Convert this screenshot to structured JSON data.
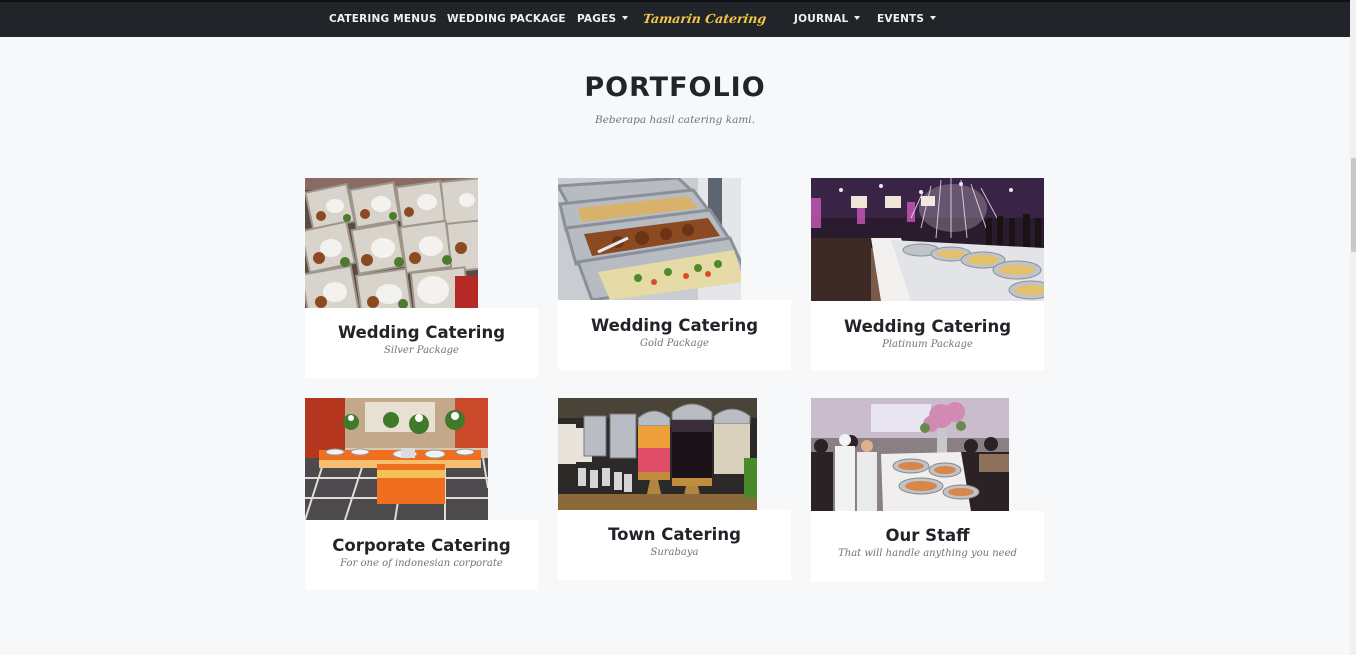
{
  "navbar": {
    "items_left": [
      {
        "label": "CATERING MENUS",
        "dropdown": false
      },
      {
        "label": "WEDDING PACKAGE",
        "dropdown": false
      },
      {
        "label": "PAGES",
        "dropdown": true
      }
    ],
    "brand": "Tamarin Catering",
    "items_right": [
      {
        "label": "JOURNAL",
        "dropdown": true
      },
      {
        "label": "EVENTS",
        "dropdown": true
      }
    ],
    "background_color": "#212429",
    "brand_color": "#f3c64a"
  },
  "portfolio": {
    "title": "PORTFOLIO",
    "subtitle": "Beberapa hasil catering kami.",
    "items": [
      {
        "title": "Wedding Catering",
        "subtitle": "Silver Package",
        "image": "food-boxes-photo"
      },
      {
        "title": "Wedding Catering",
        "subtitle": "Gold Package",
        "image": "chafing-dishes-photo"
      },
      {
        "title": "Wedding Catering",
        "subtitle": "Platinum Package",
        "image": "banquet-hall-photo"
      },
      {
        "title": "Corporate Catering",
        "subtitle": "For one of indonesian corporate",
        "image": "buffet-table-photo"
      },
      {
        "title": "Town Catering",
        "subtitle": "Surabaya",
        "image": "drink-dispensers-photo"
      },
      {
        "title": "Our Staff",
        "subtitle": "That will handle anything you need",
        "image": "staff-serving-photo"
      }
    ]
  }
}
